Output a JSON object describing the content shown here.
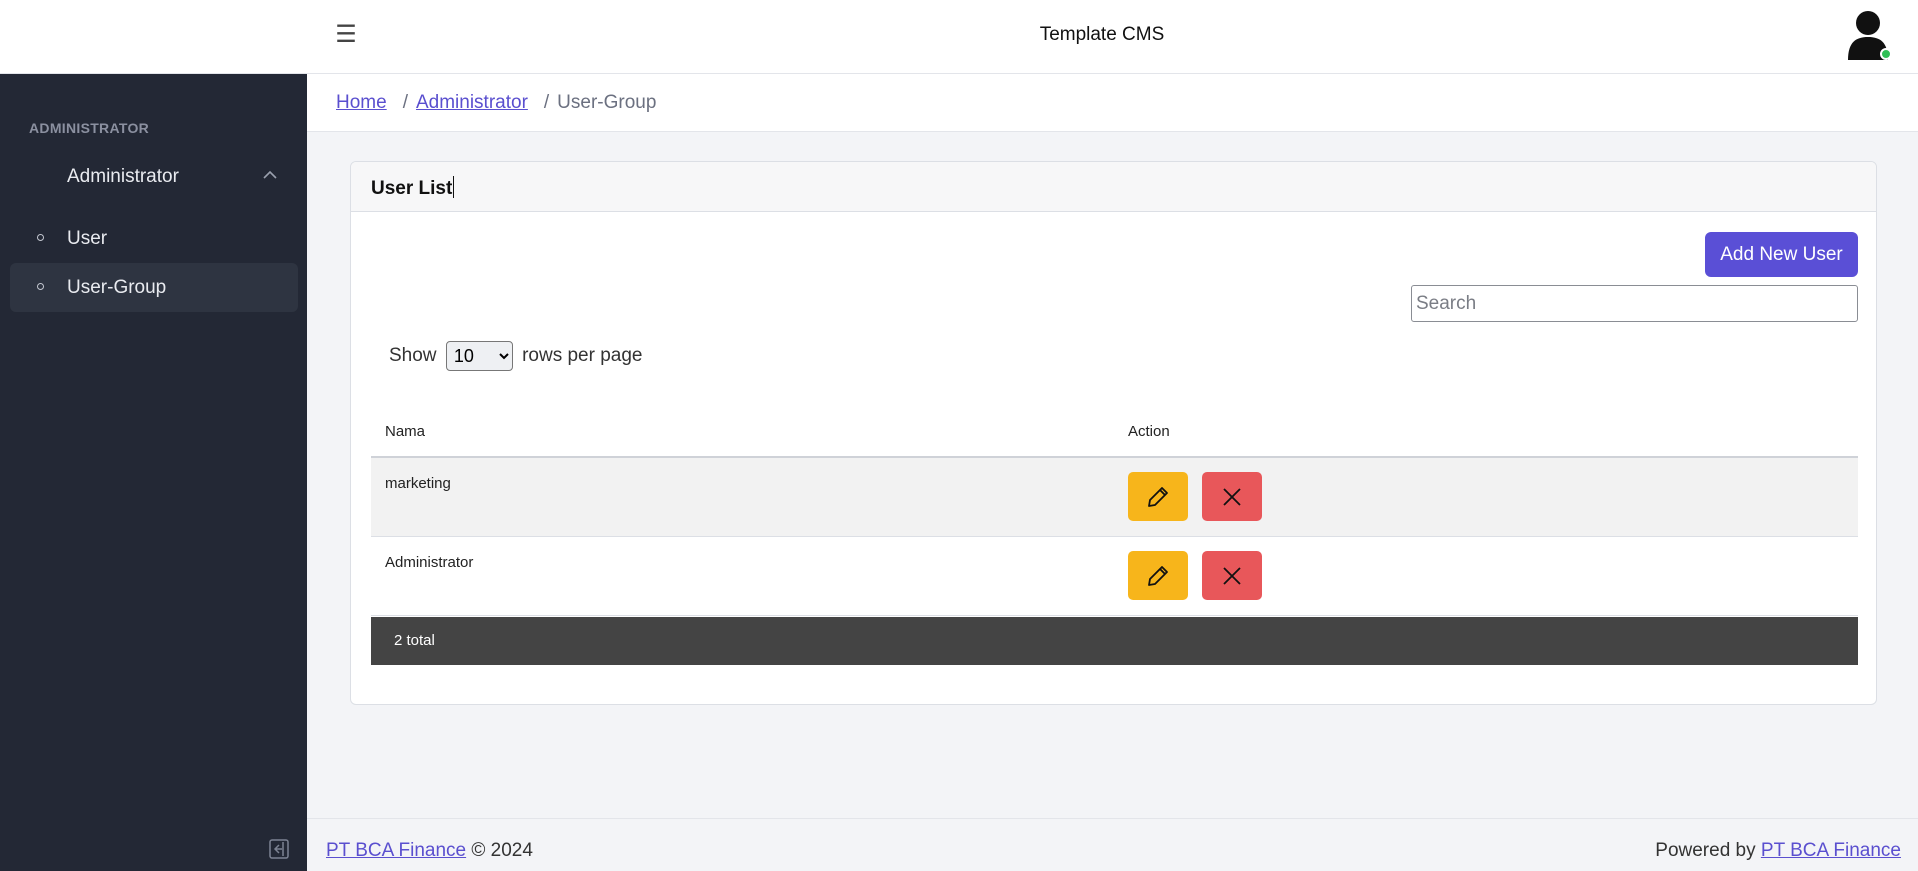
{
  "header": {
    "app_title": "Template CMS",
    "menu_icon": "hamburger-icon",
    "avatar_icon": "user-avatar-icon",
    "online_status_color": "#2fbf55"
  },
  "sidebar": {
    "section_title": "ADMINISTRATOR",
    "parent": {
      "label": "Administrator",
      "icon": "chevron-up-icon",
      "expanded": true
    },
    "items": [
      {
        "label": "User",
        "active": false
      },
      {
        "label": "User-Group",
        "active": true
      }
    ],
    "collapse_icon": "collapse-sidebar-icon"
  },
  "breadcrumb": {
    "items": [
      {
        "label": "Home",
        "link": true
      },
      {
        "label": "Administrator",
        "link": true
      },
      {
        "label": "User-Group",
        "link": false
      }
    ],
    "separator": "/"
  },
  "card": {
    "title": "User List",
    "add_button": "Add New User",
    "search_placeholder": "Search",
    "rows_label_before": "Show",
    "rows_label_after": "rows per page",
    "rows_selected": "10",
    "columns": [
      "Nama",
      "Action"
    ],
    "rows": [
      {
        "name": "marketing"
      },
      {
        "name": "Administrator"
      }
    ],
    "total_label": "2 total"
  },
  "footer": {
    "company_link": "PT BCA Finance",
    "copyright": "© 2024",
    "powered_by": "Powered by",
    "powered_link": "PT BCA Finance"
  },
  "colors": {
    "primary": "#5a4fd6",
    "sidebar_bg": "#232835",
    "edit_button": "#f7b51b",
    "delete_button": "#e8575a",
    "table_footer": "#444444"
  }
}
